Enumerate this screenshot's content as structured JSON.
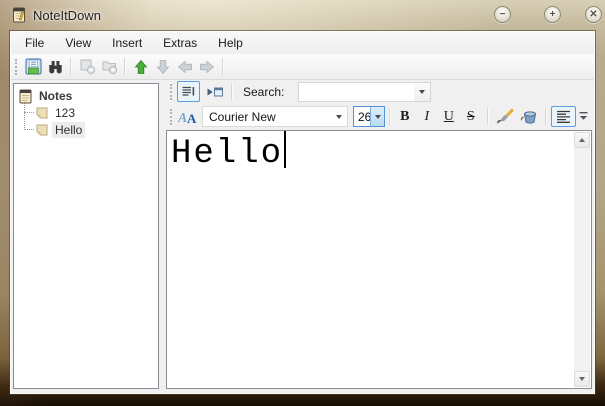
{
  "window": {
    "title": "NoteItDown",
    "controls": {
      "minimize": "−",
      "maximize": "+",
      "close": "✕"
    }
  },
  "menu": {
    "items": [
      "File",
      "View",
      "Insert",
      "Extras",
      "Help"
    ]
  },
  "toolbar_icons": {
    "save": "floppy-disk",
    "find": "binoculars",
    "add_note": "note-plus (disabled)",
    "add_folder": "folder-plus (disabled)",
    "move_up": "green-arrow-up",
    "move_down": "gray-arrow-down (disabled)",
    "back": "gray-arrow-left (disabled)",
    "forward": "gray-arrow-right (disabled)"
  },
  "sidebar": {
    "root_label": "Notes",
    "items": [
      {
        "label": "123",
        "selected": false
      },
      {
        "label": "Hello",
        "selected": true
      }
    ]
  },
  "search": {
    "label": "Search:",
    "value": ""
  },
  "format": {
    "font_name": "Courier New",
    "font_size": "26",
    "bold": "B",
    "italic": "I",
    "underline": "U",
    "strike": "S"
  },
  "editor": {
    "text": "Hello"
  },
  "icons": {
    "app": "notepad",
    "note_text_toggle": "text-lines-with-cursor",
    "jump_to_note": "arrow-into-note",
    "font_picker": "double-letter-a",
    "font_color": "paintbrush",
    "highlight_color": "paint-bucket",
    "align_left": "align-left-lines",
    "toolbar_overflow": "bar-chevron-down",
    "tree_root": "notepad",
    "tree_item": "sticky-note"
  },
  "colors": {
    "toggle_border": "#5c9ce0",
    "toggle_fill": "#eaf4fc",
    "focused_combo_border": "#4f94d8",
    "enabled_arrow_green": "#4aae3c",
    "frame_tan": "#b3a78a",
    "tree_selection": "#ececec"
  }
}
